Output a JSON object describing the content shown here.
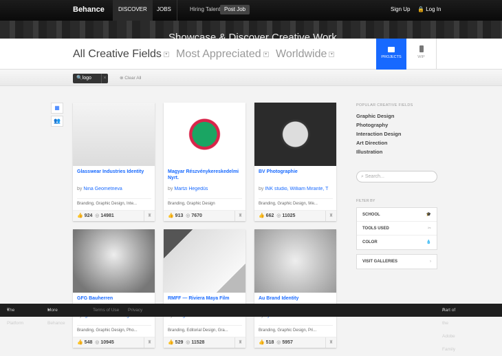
{
  "topnav": {
    "logo": "Behance",
    "discover": "DISCOVER",
    "jobs": "JOBS",
    "hiring": "Hiring Talent?",
    "post_job": "Post Job",
    "sign_up": "Sign Up",
    "log_in": "Log In"
  },
  "hero": {
    "headline": "Showcase & Discover Creative Work"
  },
  "filters": {
    "field": "All Creative Fields",
    "sort": "Most Appreciated",
    "location": "Worldwide",
    "projects": "PROJECTS",
    "wip": "WIP"
  },
  "search_bar": {
    "tag": "logo",
    "clear": "Clear All"
  },
  "projects": [
    {
      "title": "Glasswear Industries Identity",
      "by": "by",
      "owner": "Nina Geometrieva",
      "tags": "Branding, Graphic Design, Inte...",
      "likes": "924",
      "views": "14981"
    },
    {
      "title": "Magyar Részvénykereskedelmi Nyrt.",
      "by": "by",
      "owner": "Martzi Hegedűs",
      "tags": "Branding, Graphic Design",
      "likes": "913",
      "views": "7670"
    },
    {
      "title": "BV Photographie",
      "by": "by",
      "owner": "INK studio, William Mirante, T",
      "tags": "Branding, Graphic Design, We...",
      "likes": "662",
      "views": "11025"
    },
    {
      "title": "GFG Bauherren",
      "by": "by",
      "owner": "Ignacio Fanner Design Fa...",
      "tags": "Branding, Graphic Design, Pho...",
      "likes": "548",
      "views": "10945"
    },
    {
      "title": "RMFF — Riviera Maya Film",
      "by": "by",
      "owner": "Anagrama",
      "tags": "Branding, Editorial Design, Gra...",
      "likes": "529",
      "views": "11528"
    },
    {
      "title": "Au Brand Identity",
      "by": "by",
      "owner": "Ilyuko Chan",
      "tags": "Branding, Graphic Design, Pri...",
      "likes": "518",
      "views": "5957"
    }
  ],
  "sidebar": {
    "popular_heading": "POPULAR CREATIVE FIELDS",
    "fields": [
      "Graphic Design",
      "Photography",
      "Interaction Design",
      "Art Direction",
      "Illustration"
    ],
    "search_placeholder": "Search...",
    "filter_heading": "FILTER BY",
    "school": "SCHOOL",
    "tools": "TOOLS USED",
    "color": "COLOR",
    "galleries": "VISIT GALLERIES"
  },
  "footer": {
    "platform": "The Platform",
    "more": "More Behance",
    "terms": "Terms of Use",
    "privacy": "Privacy",
    "adobe": "Part of the Adobe Family"
  },
  "colors": {
    "accent": "#1769ff"
  }
}
